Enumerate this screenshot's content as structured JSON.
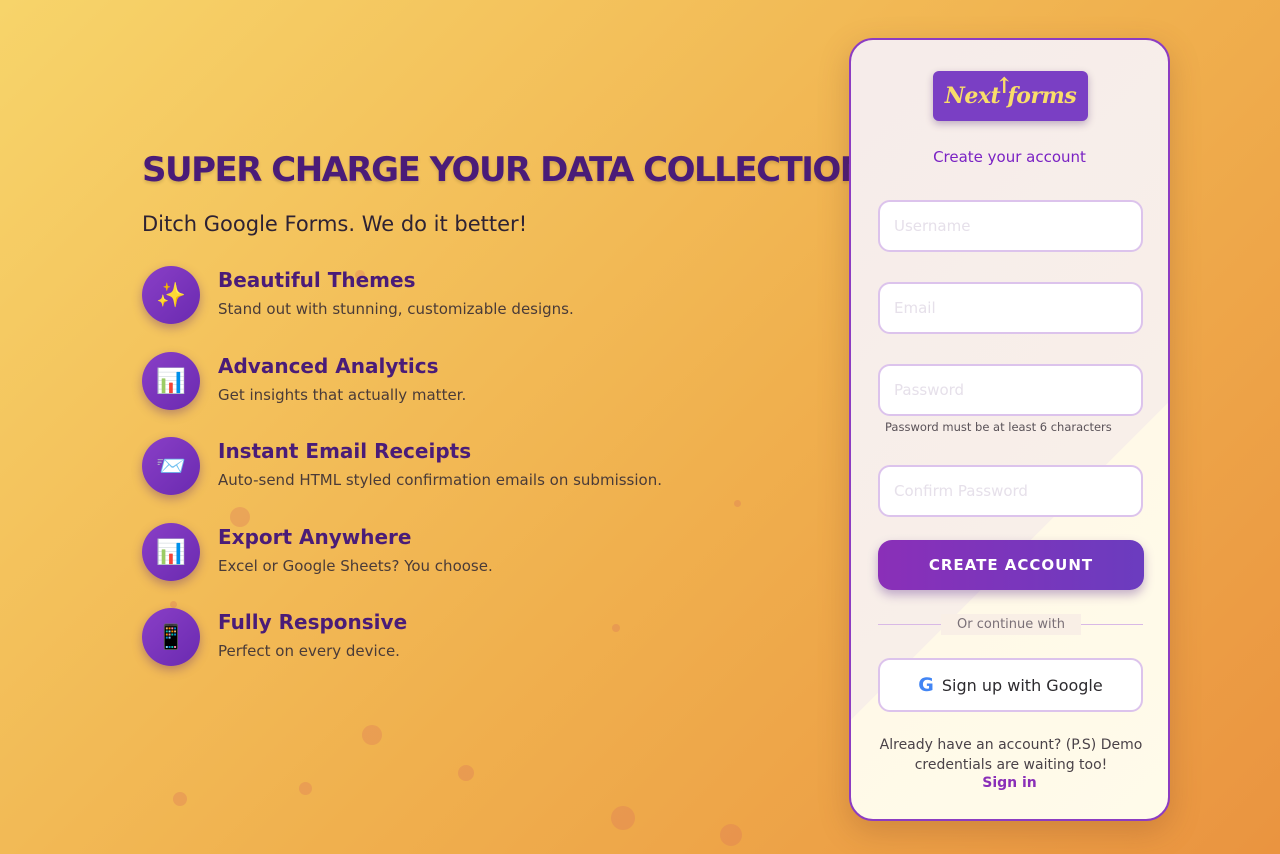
{
  "hero": {
    "title": "SUPER CHARGE YOUR DATA COLLECTION",
    "subtitle": "Ditch Google Forms. We do it better!",
    "features": [
      {
        "icon": "sparkles-icon",
        "glyph": "✨",
        "title": "Beautiful Themes",
        "desc": "Stand out with stunning, customizable designs."
      },
      {
        "icon": "bar-chart-icon",
        "glyph": "📊",
        "title": "Advanced Analytics",
        "desc": "Get insights that actually matter."
      },
      {
        "icon": "envelope-icon",
        "glyph": "📨",
        "title": "Instant Email Receipts",
        "desc": "Auto-send HTML styled confirmation emails on submission."
      },
      {
        "icon": "bar-chart-icon",
        "glyph": "📊",
        "title": "Export Anywhere",
        "desc": "Excel or Google Sheets? You choose."
      },
      {
        "icon": "mobile-phone-icon",
        "glyph": "📱",
        "title": "Fully Responsive",
        "desc": "Perfect on every device."
      }
    ]
  },
  "card": {
    "logo_text": "Next forms",
    "subtitle": "Create your account",
    "fields": {
      "username_placeholder": "Username",
      "email_placeholder": "Email",
      "password_placeholder": "Password",
      "confirm_placeholder": "Confirm Password"
    },
    "password_hint": "Password must be at least 6 characters",
    "create_button": "CREATE ACCOUNT",
    "divider_text": "Or continue with",
    "google_button": "Sign up with Google",
    "footer_text": "Already have an account? (P.S) Demo credentials are waiting too!",
    "signin_link": "Sign in"
  },
  "colors": {
    "accent": "#4a1c78",
    "button": "#7a3fc4",
    "link": "#8a2fb8"
  }
}
